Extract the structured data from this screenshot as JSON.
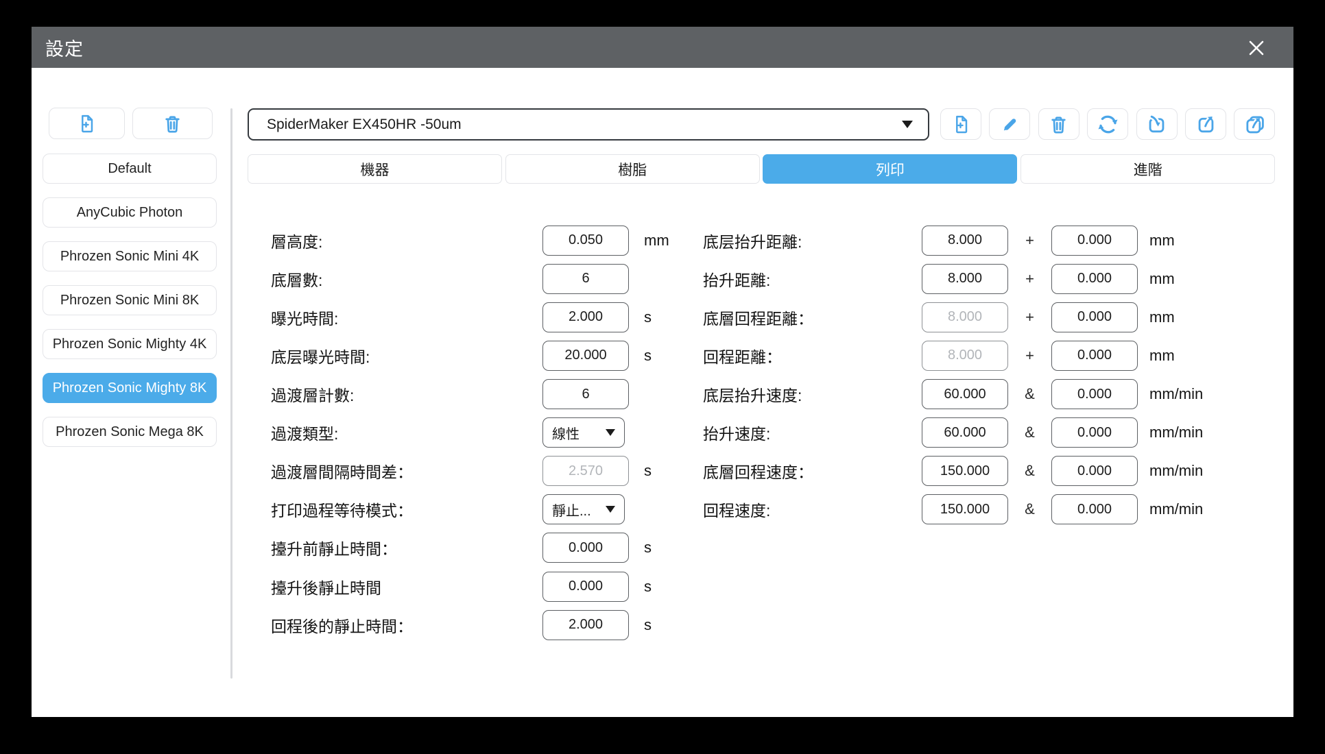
{
  "window": {
    "title": "設定",
    "close_icon": "close-icon"
  },
  "colors": {
    "accent": "#4babe9",
    "titlebar": "#5e6164",
    "icon_blue": "#4aa5e8"
  },
  "sidebar": {
    "action_buttons": [
      {
        "name": "new-profile",
        "icon": "file-plus-icon"
      },
      {
        "name": "delete-profile",
        "icon": "trash-icon"
      }
    ],
    "profiles": [
      {
        "label": "Default",
        "selected": false
      },
      {
        "label": "AnyCubic Photon",
        "selected": false
      },
      {
        "label": "Phrozen Sonic Mini 4K",
        "selected": false
      },
      {
        "label": "Phrozen Sonic Mini 8K",
        "selected": false
      },
      {
        "label": "Phrozen Sonic Mighty 4K",
        "selected": false
      },
      {
        "label": "Phrozen Sonic Mighty 8K",
        "selected": true
      },
      {
        "label": "Phrozen Sonic Mega 8K",
        "selected": false
      }
    ]
  },
  "toolbar": {
    "preset_select": {
      "value": "SpiderMaker EX450HR -50um"
    },
    "buttons": [
      {
        "name": "new-preset",
        "icon": "file-plus-icon"
      },
      {
        "name": "rename-preset",
        "icon": "pencil-icon"
      },
      {
        "name": "delete-preset",
        "icon": "trash-icon"
      },
      {
        "name": "refresh-presets",
        "icon": "refresh-icon"
      },
      {
        "name": "import-preset",
        "icon": "import-icon"
      },
      {
        "name": "export-preset",
        "icon": "export-icon"
      },
      {
        "name": "export-all-presets",
        "icon": "export-all-icon"
      }
    ]
  },
  "tabs": [
    {
      "label": "機器",
      "selected": false
    },
    {
      "label": "樹脂",
      "selected": false
    },
    {
      "label": "列印",
      "selected": true
    },
    {
      "label": "進階",
      "selected": false
    }
  ],
  "form": {
    "left_rows": [
      {
        "label": "層高度:",
        "type": "input",
        "value": "0.050",
        "unit": "mm",
        "disabled": false
      },
      {
        "label": "底層數:",
        "type": "input",
        "value": "6",
        "unit": "",
        "disabled": false
      },
      {
        "label": "曝光時間:",
        "type": "input",
        "value": "2.000",
        "unit": "s",
        "disabled": false
      },
      {
        "label": "底层曝光時間:",
        "type": "input",
        "value": "20.000",
        "unit": "s",
        "disabled": false
      },
      {
        "label": "過渡層計數:",
        "type": "input",
        "value": "6",
        "unit": "",
        "disabled": false
      },
      {
        "label": "過渡類型:",
        "type": "select",
        "value": "線性",
        "unit": "",
        "disabled": false
      },
      {
        "label": "過渡層間隔時間差：",
        "type": "input",
        "value": "2.570",
        "unit": "s",
        "disabled": true
      },
      {
        "label": "打印過程等待模式：",
        "type": "select",
        "value": "靜止...",
        "unit": "",
        "disabled": false
      },
      {
        "label": "擡升前靜止時間：",
        "type": "input",
        "value": "0.000",
        "unit": "s",
        "disabled": false
      },
      {
        "label": "擡升後靜止時間",
        "type": "input",
        "value": "0.000",
        "unit": "s",
        "disabled": false
      },
      {
        "label": "回程後的靜止時間：",
        "type": "input",
        "value": "2.000",
        "unit": "s",
        "disabled": false
      }
    ],
    "right_rows": [
      {
        "label": "底层抬升距離:",
        "value1": "8.000",
        "disabled1": false,
        "sep": "+",
        "value2": "0.000",
        "unit": "mm"
      },
      {
        "label": "抬升距離:",
        "value1": "8.000",
        "disabled1": false,
        "sep": "+",
        "value2": "0.000",
        "unit": "mm"
      },
      {
        "label": "底層回程距離：",
        "value1": "8.000",
        "disabled1": true,
        "sep": "+",
        "value2": "0.000",
        "unit": "mm"
      },
      {
        "label": "回程距離：",
        "value1": "8.000",
        "disabled1": true,
        "sep": "+",
        "value2": "0.000",
        "unit": "mm"
      },
      {
        "label": "底层抬升速度:",
        "value1": "60.000",
        "disabled1": false,
        "sep": "&",
        "value2": "0.000",
        "unit": "mm/min"
      },
      {
        "label": "抬升速度:",
        "value1": "60.000",
        "disabled1": false,
        "sep": "&",
        "value2": "0.000",
        "unit": "mm/min"
      },
      {
        "label": "底層回程速度：",
        "value1": "150.000",
        "disabled1": false,
        "sep": "&",
        "value2": "0.000",
        "unit": "mm/min"
      },
      {
        "label": "回程速度:",
        "value1": "150.000",
        "disabled1": false,
        "sep": "&",
        "value2": "0.000",
        "unit": "mm/min"
      }
    ]
  }
}
